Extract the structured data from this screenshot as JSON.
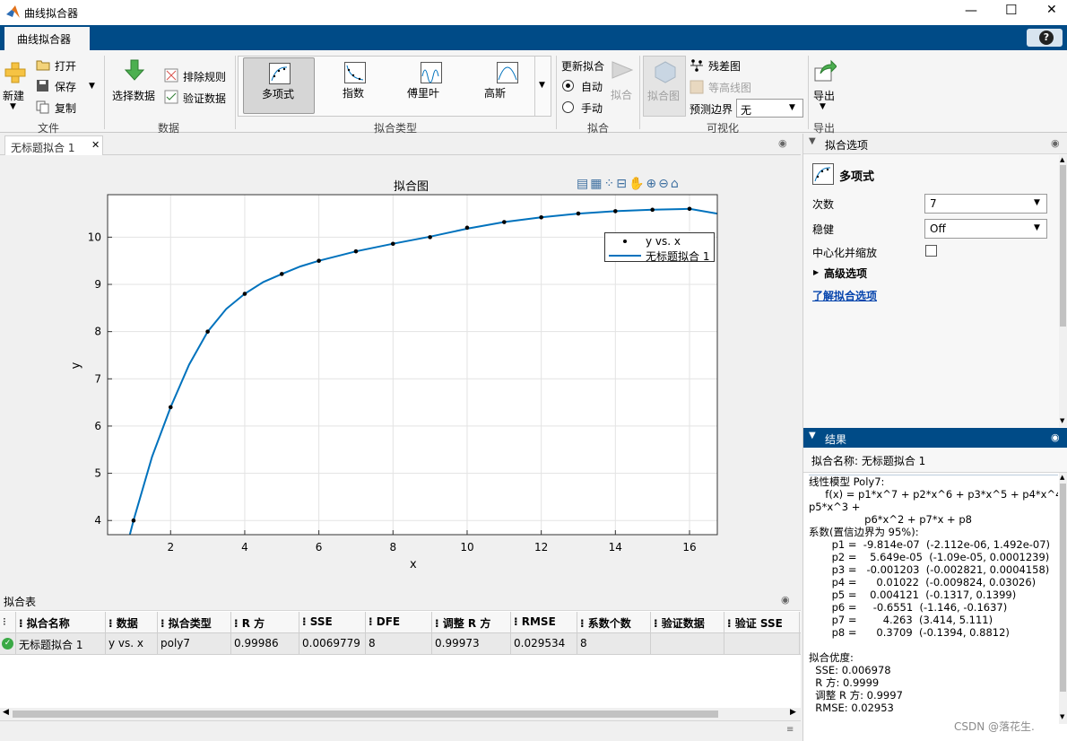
{
  "window": {
    "title": "曲线拟合器",
    "min": "—",
    "max": "☐",
    "close": "✕"
  },
  "app_tab": "曲线拟合器",
  "help": "?",
  "toolstrip": {
    "new": "新建",
    "open": "打开",
    "save": "保存",
    "copy": "复制",
    "file_group": "文件",
    "select_data": "选择数据",
    "exclusion": "排除规则",
    "validation": "验证数据",
    "data_group": "数据",
    "fit_types": [
      "多项式",
      "指数",
      "傅里叶",
      "高斯"
    ],
    "fittype_group": "拟合类型",
    "update_fit": "更新拟合",
    "auto": "自动",
    "manual": "手动",
    "fit": "拟合",
    "fit_group": "拟合",
    "fit_plot": "拟合图",
    "residuals": "残差图",
    "contour": "等高线图",
    "pred_bounds": "预测边界",
    "pred_value": "无",
    "vis_group": "可视化",
    "export": "导出",
    "export_group": "导出"
  },
  "doc_tab": "无标题拟合 1",
  "plot": {
    "title": "拟合图",
    "xlabel": "x",
    "ylabel": "y",
    "legend": [
      "y vs. x",
      "无标题拟合 1"
    ]
  },
  "chart_data": {
    "type": "scatter",
    "title": "拟合图",
    "xlabel": "x",
    "ylabel": "y",
    "xlim": [
      0.3,
      16.75
    ],
    "ylim": [
      3.7,
      10.9
    ],
    "xticks": [
      2,
      4,
      6,
      8,
      10,
      12,
      14,
      16
    ],
    "yticks": [
      4,
      5,
      6,
      7,
      8,
      9,
      10
    ],
    "grid": true,
    "legend_position": "top-right",
    "series": [
      {
        "name": "y vs. x",
        "kind": "points",
        "x": [
          1,
          2,
          3,
          4,
          5,
          6,
          7,
          8,
          9,
          10,
          11,
          12,
          13,
          14,
          15,
          16
        ],
        "y": [
          4.0,
          6.4,
          8.0,
          8.8,
          9.22,
          9.5,
          9.7,
          9.86,
          10.0,
          10.2,
          10.32,
          10.42,
          10.5,
          10.55,
          10.58,
          10.6
        ]
      },
      {
        "name": "无标题拟合 1",
        "kind": "line",
        "color": "#0072bd",
        "x": [
          0.9,
          1,
          1.5,
          2,
          2.5,
          3,
          3.5,
          4,
          4.5,
          5,
          5.5,
          6,
          7,
          8,
          9,
          10,
          11,
          12,
          13,
          14,
          15,
          16,
          16.75
        ],
        "y": [
          3.7,
          4.0,
          5.35,
          6.4,
          7.3,
          8.0,
          8.48,
          8.8,
          9.05,
          9.22,
          9.38,
          9.5,
          9.7,
          9.86,
          10.01,
          10.18,
          10.32,
          10.42,
          10.5,
          10.55,
          10.58,
          10.6,
          10.5
        ]
      }
    ]
  },
  "options": {
    "header": "拟合选项",
    "model": "多项式",
    "degree_label": "次数",
    "degree": "7",
    "robust_label": "稳健",
    "robust": "Off",
    "center_label": "中心化并缩放",
    "advanced": "高级选项",
    "learn": "了解拟合选项"
  },
  "results": {
    "header": "结果",
    "fit_name": "拟合名称: 无标题拟合 1",
    "lines": [
      "线性模型 Poly7:",
      "     f(x) = p1*x^7 + p2*x^6 + p3*x^5 + p4*x^4 +",
      "p5*x^3 +",
      "                 p6*x^2 + p7*x + p8",
      "系数(置信边界为 95%):",
      "       p1 =  -9.814e-07  (-2.112e-06, 1.492e-07)",
      "       p2 =    5.649e-05  (-1.09e-05, 0.0001239)",
      "       p3 =   -0.001203  (-0.002821, 0.0004158)",
      "       p4 =      0.01022  (-0.009824, 0.03026)",
      "       p5 =    0.004121  (-0.1317, 0.1399)",
      "       p6 =     -0.6551  (-1.146, -0.1637)",
      "       p7 =        4.263  (3.414, 5.111)",
      "       p8 =      0.3709  (-0.1394, 0.8812)",
      "",
      "拟合优度:",
      "  SSE: 0.006978",
      "  R 方: 0.9999",
      "  调整 R 方: 0.9997",
      "  RMSE: 0.02953"
    ]
  },
  "table": {
    "header": "拟合表",
    "columns": [
      "拟合名称",
      "数据",
      "拟合类型",
      "R 方",
      "SSE",
      "DFE",
      "调整 R 方",
      "RMSE",
      "系数个数",
      "验证数据",
      "验证 SSE"
    ],
    "row": [
      "无标题拟合 1",
      "y vs. x",
      "poly7",
      "0.99986",
      "0.0069779",
      "8",
      "0.99973",
      "0.029534",
      "8",
      "",
      ""
    ]
  },
  "watermark": "CSDN @落花生."
}
